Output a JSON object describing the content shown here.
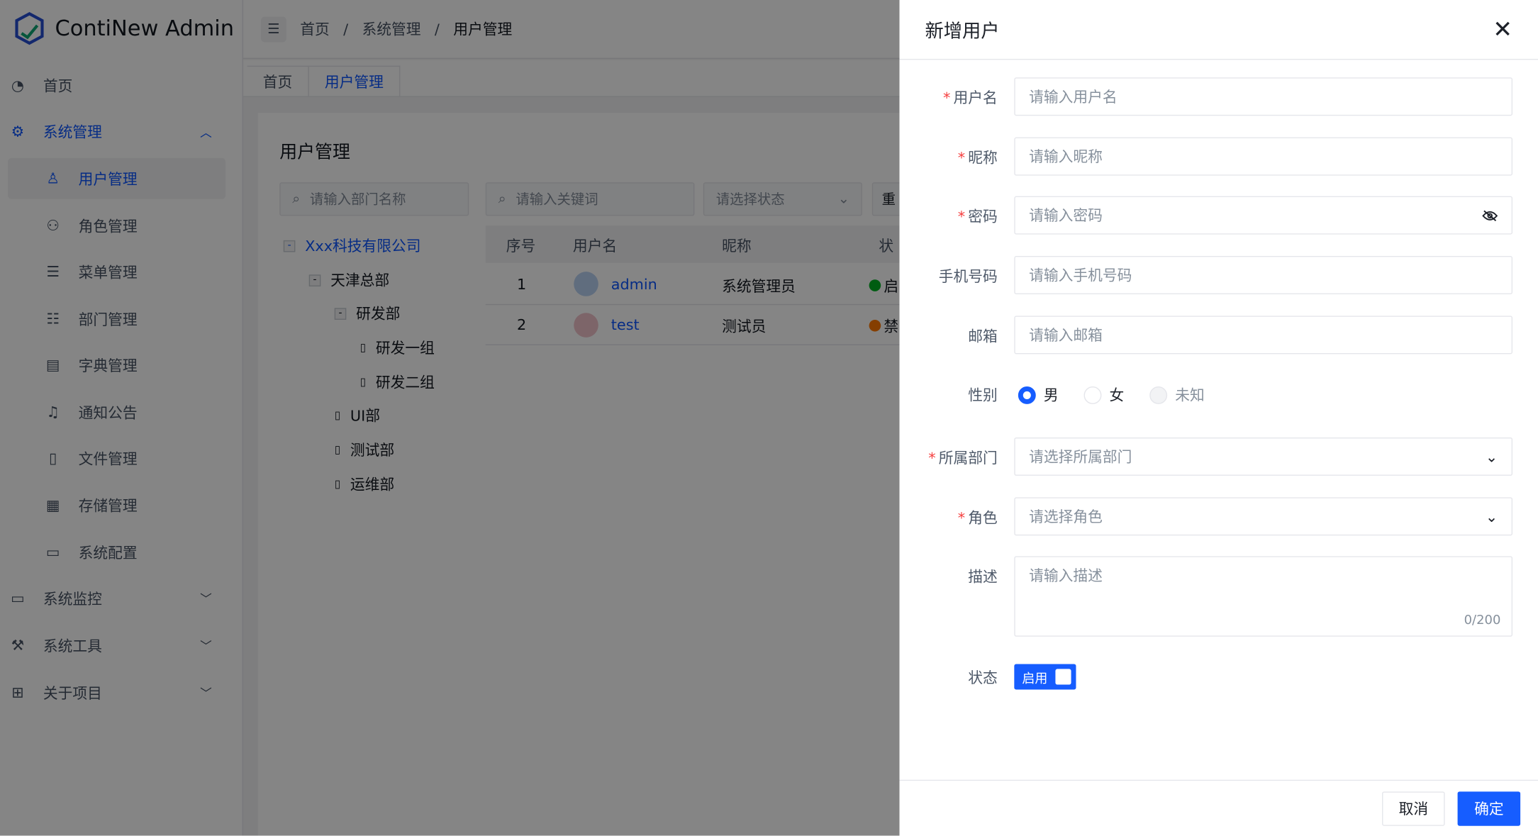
{
  "app": {
    "title": "ContiNew Admin"
  },
  "sidebar": {
    "items": [
      {
        "label": "首页",
        "icon": "dashboard-icon"
      },
      {
        "label": "系统管理",
        "icon": "gear-icon",
        "expanded": true
      },
      {
        "label": "用户管理",
        "icon": "user-icon",
        "selected": true
      },
      {
        "label": "角色管理",
        "icon": "users-icon"
      },
      {
        "label": "菜单管理",
        "icon": "menu-icon"
      },
      {
        "label": "部门管理",
        "icon": "list-icon"
      },
      {
        "label": "字典管理",
        "icon": "dictionary-icon"
      },
      {
        "label": "通知公告",
        "icon": "bell-icon"
      },
      {
        "label": "文件管理",
        "icon": "file-icon"
      },
      {
        "label": "存储管理",
        "icon": "storage-icon"
      },
      {
        "label": "系统配置",
        "icon": "monitor-icon"
      },
      {
        "label": "系统监控",
        "icon": "monitor-chart-icon"
      },
      {
        "label": "系统工具",
        "icon": "wrench-icon"
      },
      {
        "label": "关于项目",
        "icon": "grid-icon"
      }
    ]
  },
  "breadcrumb": [
    "首页",
    "系统管理",
    "用户管理"
  ],
  "tabs": [
    {
      "label": "首页"
    },
    {
      "label": "用户管理",
      "active": true
    }
  ],
  "main": {
    "title": "用户管理",
    "dept_search_placeholder": "请输入部门名称",
    "keyword_placeholder": "请输入关键词",
    "status_placeholder": "请选择状态",
    "reset_label": "重",
    "tree": [
      "Xxx科技有限公司",
      "天津总部",
      "研发部",
      "研发一组",
      "研发二组",
      "UI部",
      "测试部",
      "运维部"
    ],
    "columns": [
      "序号",
      "用户名",
      "昵称",
      "状"
    ],
    "rows": [
      {
        "index": "1",
        "username": "admin",
        "nickname": "系统管理员",
        "status": "启",
        "status_color": "#00b42a"
      },
      {
        "index": "2",
        "username": "test",
        "nickname": "测试员",
        "status": "禁",
        "status_color": "#ff7d00"
      }
    ]
  },
  "drawer": {
    "title": "新增用户",
    "fields": {
      "username": {
        "label": "用户名",
        "placeholder": "请输入用户名"
      },
      "nickname": {
        "label": "昵称",
        "placeholder": "请输入昵称"
      },
      "password": {
        "label": "密码",
        "placeholder": "请输入密码"
      },
      "phone": {
        "label": "手机号码",
        "placeholder": "请输入手机号码"
      },
      "email": {
        "label": "邮箱",
        "placeholder": "请输入邮箱"
      },
      "gender": {
        "label": "性别",
        "options": [
          "男",
          "女",
          "未知"
        ],
        "selected": "男"
      },
      "dept": {
        "label": "所属部门",
        "placeholder": "请选择所属部门"
      },
      "role": {
        "label": "角色",
        "placeholder": "请选择角色"
      },
      "description": {
        "label": "描述",
        "placeholder": "请输入描述",
        "counter": "0/200"
      },
      "status": {
        "label": "状态",
        "value": "启用"
      }
    },
    "cancel_label": "取消",
    "confirm_label": "确定"
  },
  "colors": {
    "primary": "#165dff",
    "required": "#f53f3f"
  }
}
